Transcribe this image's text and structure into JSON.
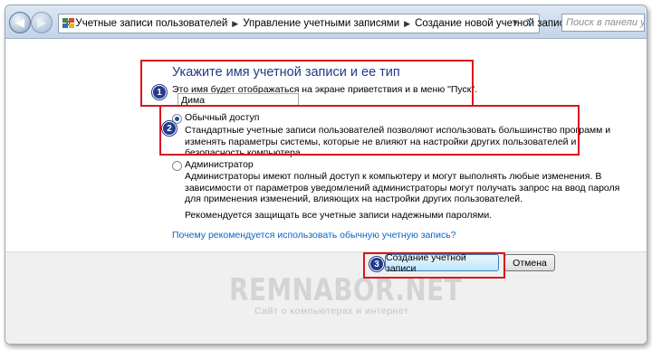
{
  "nav": {
    "back_glyph": "◀",
    "forward_glyph": "▶",
    "breadcrumb_root": "«",
    "breadcrumbs": [
      "Учетные записи пользователей",
      "Управление учетными записями",
      "Создание новой учетной записи"
    ],
    "refresh_glyph": "↻",
    "search_placeholder": "Поиск в панели упр"
  },
  "form": {
    "heading": "Укажите имя учетной записи и ее тип",
    "hint": "Это имя будет отображаться на экране приветствия и в меню \"Пуск\".",
    "name_value": "Дима",
    "standard": {
      "label": "Обычный доступ",
      "selected": true,
      "desc": [
        "Стандартные учетные записи пользователей позволяют использовать большинство программ и",
        "изменять параметры системы, которые не влияют на настройки других пользователей и",
        "безопасность компьютера."
      ]
    },
    "admin": {
      "label": "Администратор",
      "selected": false,
      "desc": [
        "Администраторы имеют полный доступ к компьютеру и могут выполнять любые изменения. В",
        "зависимости от параметров уведомлений администраторы могут получать запрос на ввод пароля",
        "для применения изменений, влияющих на настройки других пользователей."
      ]
    },
    "password_note": "Рекомендуется защищать все учетные записи надежными паролями.",
    "help_link": "Почему рекомендуется использовать обычную учетную запись?"
  },
  "buttons": {
    "create": "Создание учетной записи",
    "cancel": "Отмена"
  },
  "markers": [
    "1",
    "2",
    "3"
  ],
  "watermark": {
    "title": "REMNABOR.NET",
    "subtitle": "Сайт о компьютерах и интернет"
  },
  "colors": {
    "highlight": "#d7161e",
    "marker": "#223b8f",
    "heading": "#1e3a87",
    "link": "#0b64c4"
  }
}
